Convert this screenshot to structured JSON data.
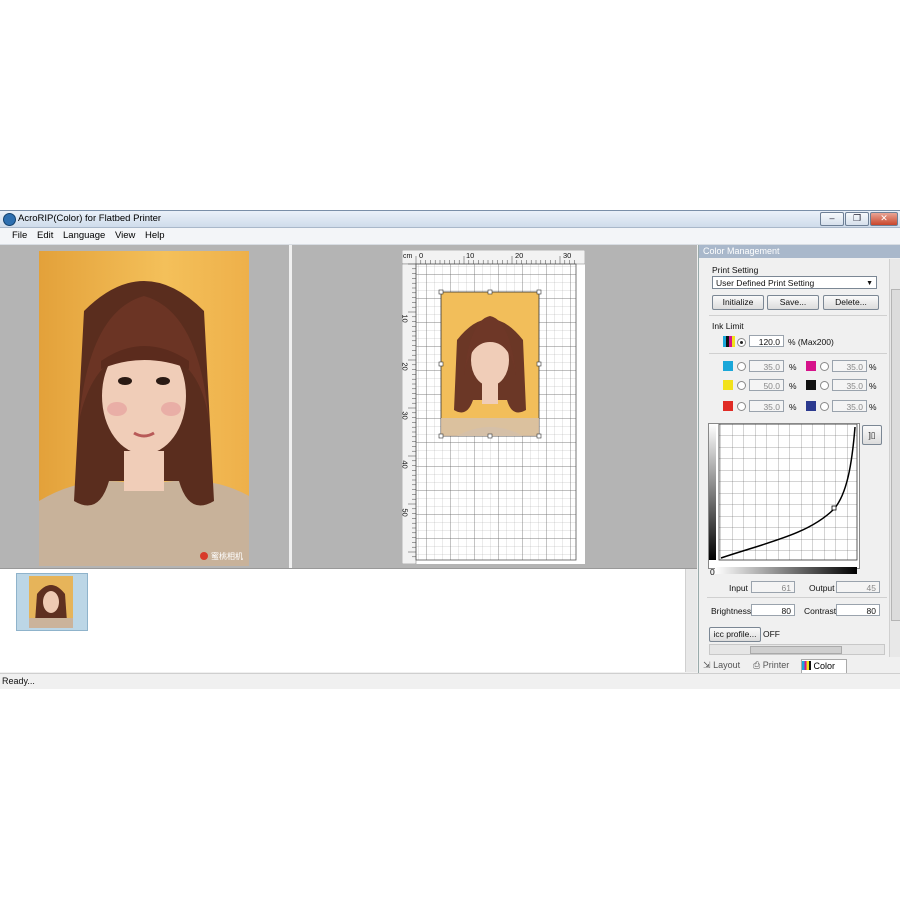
{
  "window": {
    "title": "AcroRIP(Color) for Flatbed Printer"
  },
  "menu": [
    "File",
    "Edit",
    "Language",
    "View",
    "Help"
  ],
  "ruler": {
    "unit": "cm",
    "top_ticks": [
      "0",
      "10",
      "20",
      "30"
    ],
    "left_ticks": [
      "10",
      "20",
      "30",
      "40",
      "50"
    ]
  },
  "watermark": "蜜桃相机",
  "color_panel": {
    "header": "Color Management",
    "print_setting_label": "Print Setting",
    "print_setting_value": "User Defined Print Setting",
    "buttons": {
      "initialize": "Initialize",
      "save": "Save...",
      "delete": "Delete..."
    },
    "ink_limit_label": "Ink Limit",
    "ink_limit_value": "120.0",
    "ink_limit_max": "% (Max200)",
    "inks": [
      {
        "color": "#1aa7d9",
        "value": "35.0",
        "unit": "%"
      },
      {
        "color": "#d6128a",
        "value": "35.0",
        "unit": "%"
      },
      {
        "color": "#f2e21c",
        "value": "50.0",
        "unit": "%"
      },
      {
        "color": "#111111",
        "value": "35.0",
        "unit": "%"
      },
      {
        "color": "#e02b25",
        "value": "35.0",
        "unit": "%"
      },
      {
        "color": "#2c3a8f",
        "value": "35.0",
        "unit": "%"
      }
    ],
    "curve_zero_label": "0",
    "input_label": "Input",
    "input_value": "61",
    "output_label": "Output",
    "output_value": "45",
    "brightness_label": "Brightness",
    "brightness_value": "80",
    "contrast_label": "Contrast",
    "contrast_value": "80",
    "icc_button": "icc profile...",
    "icc_state": "OFF",
    "tabs": [
      "Layout",
      "Printer",
      "Color"
    ]
  },
  "status": "Ready..."
}
